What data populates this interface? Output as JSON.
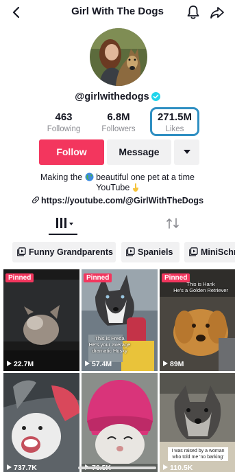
{
  "header": {
    "title": "Girl With The Dogs",
    "icons": {
      "back": "chevron-left-icon",
      "notifications": "bell-icon",
      "share": "share-arrow-icon"
    }
  },
  "profile": {
    "username": "@girlwithedogs",
    "verified": true
  },
  "stats": {
    "following": {
      "value": "463",
      "label": "Following"
    },
    "followers": {
      "value": "6.8M",
      "label": "Followers"
    },
    "likes": {
      "value": "271.5M",
      "label": "Likes"
    }
  },
  "buttons": {
    "follow": "Follow",
    "message": "Message"
  },
  "bio": {
    "line1_before": "Making the",
    "line1_after": "beautiful one pet at a time",
    "line2": "YouTube"
  },
  "link": {
    "url": "https://youtube.com/@GirlWithTheDogs"
  },
  "playlists": [
    "Funny Grandparents",
    "Spaniels",
    "MiniSchn"
  ],
  "videos": [
    {
      "pinned": "Pinned",
      "views": "22.7M",
      "caption": ""
    },
    {
      "pinned": "Pinned",
      "views": "57.4M",
      "caption": "This is Freda\nHe's your average\ndramatic Husky"
    },
    {
      "pinned": "Pinned",
      "views": "89M",
      "caption": "This is Hank\nHe's a Golden Retriever"
    },
    {
      "pinned": "",
      "views": "737.7K",
      "caption": ""
    },
    {
      "pinned": "",
      "views": "76.5K",
      "caption": ""
    },
    {
      "pinned": "",
      "views": "110.5K",
      "caption": "I was raised by a woman\nwho told me 'no barking'"
    }
  ],
  "colors": {
    "accent": "#f3365e",
    "highlight_box": "#2f8fc2",
    "verified": "#20d5ec"
  }
}
